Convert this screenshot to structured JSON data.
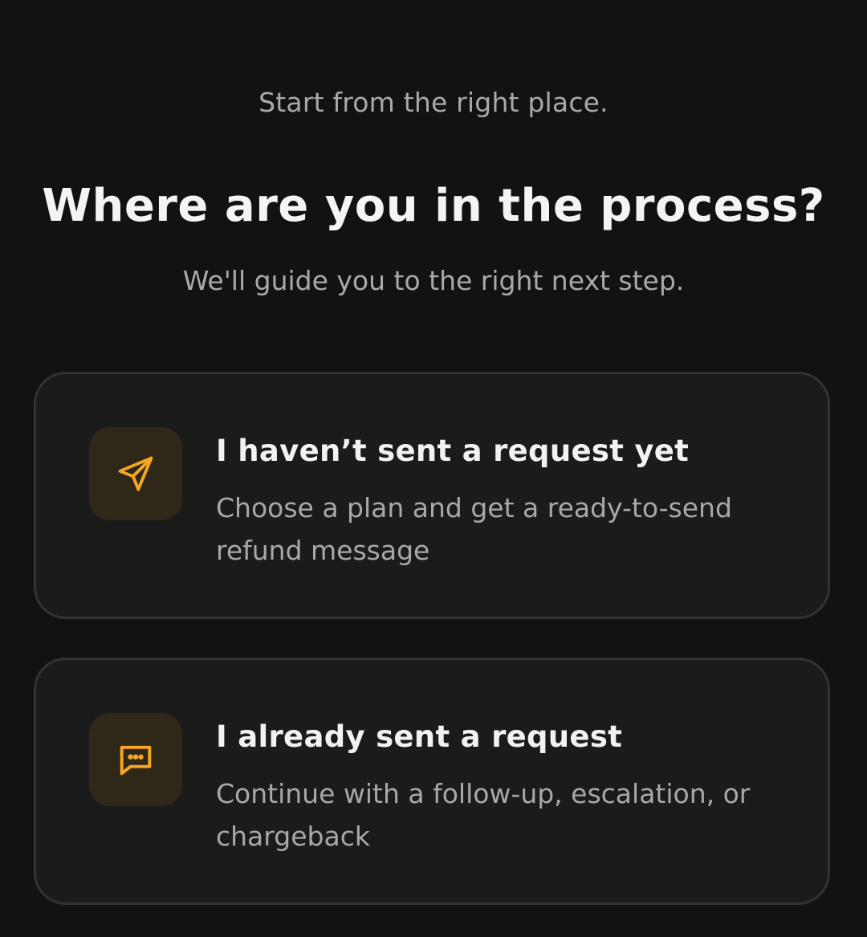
{
  "header": {
    "eyebrow": "Start from the right place.",
    "title": "Where are you in the process?",
    "subtitle": "We'll guide you to the right next step."
  },
  "options": [
    {
      "icon": "send-icon",
      "title": "I haven’t sent a request yet",
      "description": "Choose a plan and get a ready-to-send refund message"
    },
    {
      "icon": "message-icon",
      "title": "I already sent a request",
      "description": "Continue with a follow-up, escalation, or chargeback"
    }
  ],
  "colors": {
    "background": "#121212",
    "card": "#1b1b1b",
    "card_border": "#333333",
    "accent": "#f5a623",
    "icon_bg": "#2f2819"
  }
}
